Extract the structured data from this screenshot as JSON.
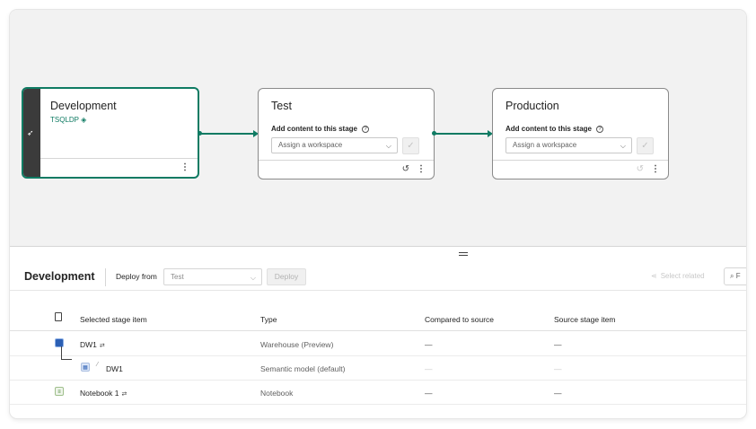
{
  "pipeline": {
    "stages": [
      {
        "name": "Development",
        "workspace": "TSQLDP",
        "workspace_icon": "diamond-icon",
        "side_icon": "rocket-icon"
      },
      {
        "name": "Test",
        "add_content_label": "Add content to this stage",
        "workspace_placeholder": "Assign a workspace"
      },
      {
        "name": "Production",
        "add_content_label": "Add content to this stage",
        "workspace_placeholder": "Assign a workspace"
      }
    ]
  },
  "toolbar": {
    "heading": "Development",
    "deploy_from_label": "Deploy from",
    "deploy_from_value": "Test",
    "deploy_button": "Deploy",
    "select_related": "Select related",
    "search_placeholder": "F"
  },
  "table": {
    "columns": [
      "Selected stage item",
      "Type",
      "Compared to source",
      "Source stage item"
    ],
    "rows": [
      {
        "name": "DW1",
        "type": "Warehouse (Preview)",
        "compared": "—",
        "source": "—",
        "icon": "warehouse-icon"
      },
      {
        "name": "DW1",
        "type": "Semantic model (default)",
        "compared": "—",
        "source": "—",
        "icon": "semantic-model-icon"
      },
      {
        "name": "Notebook 1",
        "type": "Notebook",
        "compared": "—",
        "source": "—",
        "icon": "notebook-icon"
      }
    ]
  },
  "colors": {
    "accent": "#0f7b63",
    "sidebar_dark": "#3b3b3b"
  }
}
